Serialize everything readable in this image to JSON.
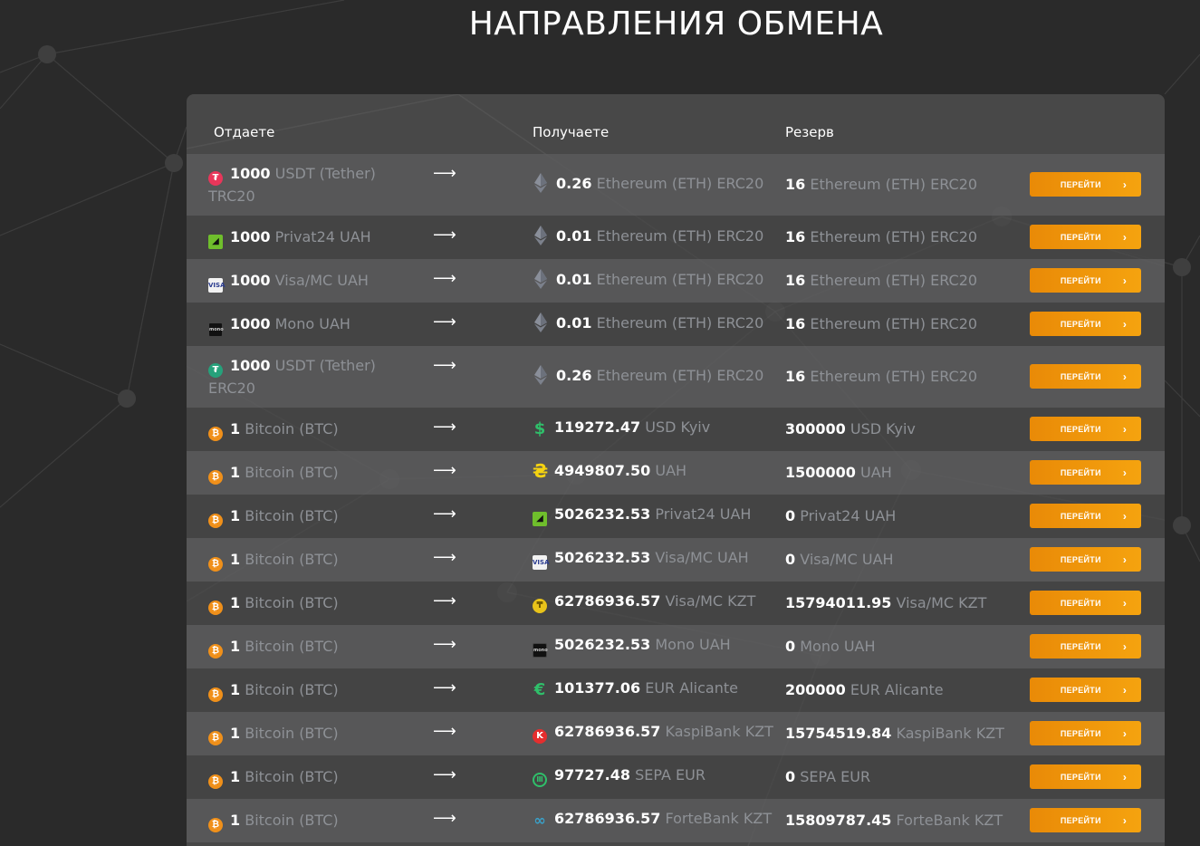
{
  "title": "НАПРАВЛЕНИЯ ОБМЕНА",
  "columns": {
    "give": "Отдаете",
    "get": "Получаете",
    "reserve": "Резерв"
  },
  "button_label": "ПЕРЕЙТИ",
  "rows": [
    {
      "give_icon": "usdt-icon",
      "give_amount": "1000",
      "give_currency": "USDT (Tether) TRC20",
      "get_icon": "ethereum-icon",
      "get_amount": "0.26",
      "get_currency": "Ethereum (ETH) ERC20",
      "reserve_amount": "16",
      "reserve_currency": "Ethereum (ETH) ERC20",
      "tall": true
    },
    {
      "give_icon": "privat24-icon",
      "give_amount": "1000",
      "give_currency": "Privat24 UAH",
      "get_icon": "ethereum-icon",
      "get_amount": "0.01",
      "get_currency": "Ethereum (ETH) ERC20",
      "reserve_amount": "16",
      "reserve_currency": "Ethereum (ETH) ERC20"
    },
    {
      "give_icon": "visa-mc-icon",
      "give_amount": "1000",
      "give_currency": "Visa/MC UAH",
      "get_icon": "ethereum-icon",
      "get_amount": "0.01",
      "get_currency": "Ethereum (ETH) ERC20",
      "reserve_amount": "16",
      "reserve_currency": "Ethereum (ETH) ERC20"
    },
    {
      "give_icon": "mono-icon",
      "give_amount": "1000",
      "give_currency": "Mono UAH",
      "get_icon": "ethereum-icon",
      "get_amount": "0.01",
      "get_currency": "Ethereum (ETH) ERC20",
      "reserve_amount": "16",
      "reserve_currency": "Ethereum (ETH) ERC20"
    },
    {
      "give_icon": "usdt-erc-icon",
      "give_amount": "1000",
      "give_currency": "USDT (Tether) ERC20",
      "get_icon": "ethereum-icon",
      "get_amount": "0.26",
      "get_currency": "Ethereum (ETH) ERC20",
      "reserve_amount": "16",
      "reserve_currency": "Ethereum (ETH) ERC20",
      "tall": true
    },
    {
      "give_icon": "bitcoin-icon",
      "give_amount": "1",
      "give_currency": "Bitcoin (BTC)",
      "get_icon": "dollar-icon",
      "get_amount": "119272.47",
      "get_currency": "USD Kyiv",
      "reserve_amount": "300000",
      "reserve_currency": "USD Kyiv"
    },
    {
      "give_icon": "bitcoin-icon",
      "give_amount": "1",
      "give_currency": "Bitcoin (BTC)",
      "get_icon": "hryvnia-icon",
      "get_amount": "4949807.50",
      "get_currency": "UAH",
      "reserve_amount": "1500000",
      "reserve_currency": "UAH"
    },
    {
      "give_icon": "bitcoin-icon",
      "give_amount": "1",
      "give_currency": "Bitcoin (BTC)",
      "get_icon": "privat24-icon",
      "get_amount": "5026232.53",
      "get_currency": "Privat24 UAH",
      "reserve_amount": "0",
      "reserve_currency": "Privat24 UAH"
    },
    {
      "give_icon": "bitcoin-icon",
      "give_amount": "1",
      "give_currency": "Bitcoin (BTC)",
      "get_icon": "visa-mc-icon",
      "get_amount": "5026232.53",
      "get_currency": "Visa/MC UAH",
      "reserve_amount": "0",
      "reserve_currency": "Visa/MC UAH"
    },
    {
      "give_icon": "bitcoin-icon",
      "give_amount": "1",
      "give_currency": "Bitcoin (BTC)",
      "get_icon": "tenge-icon",
      "get_amount": "62786936.57",
      "get_currency": "Visa/MC KZT",
      "reserve_amount": "15794011.95",
      "reserve_currency": "Visa/MC KZT"
    },
    {
      "give_icon": "bitcoin-icon",
      "give_amount": "1",
      "give_currency": "Bitcoin (BTC)",
      "get_icon": "mono-icon",
      "get_amount": "5026232.53",
      "get_currency": "Mono UAH",
      "reserve_amount": "0",
      "reserve_currency": "Mono UAH"
    },
    {
      "give_icon": "bitcoin-icon",
      "give_amount": "1",
      "give_currency": "Bitcoin (BTC)",
      "get_icon": "euro-icon",
      "get_amount": "101377.06",
      "get_currency": "EUR Alicante",
      "reserve_amount": "200000",
      "reserve_currency": "EUR Alicante"
    },
    {
      "give_icon": "bitcoin-icon",
      "give_amount": "1",
      "give_currency": "Bitcoin (BTC)",
      "get_icon": "kaspi-icon",
      "get_amount": "62786936.57",
      "get_currency": "KaspiBank KZT",
      "reserve_amount": "15754519.84",
      "reserve_currency": "KaspiBank KZT"
    },
    {
      "give_icon": "bitcoin-icon",
      "give_amount": "1",
      "give_currency": "Bitcoin (BTC)",
      "get_icon": "sepa-bank-icon",
      "get_amount": "97727.48",
      "get_currency": "SEPA EUR",
      "reserve_amount": "0",
      "reserve_currency": "SEPA EUR"
    },
    {
      "give_icon": "bitcoin-icon",
      "give_amount": "1",
      "give_currency": "Bitcoin (BTC)",
      "get_icon": "fortebank-icon",
      "get_amount": "62786936.57",
      "get_currency": "ForteBank KZT",
      "reserve_amount": "15809787.45",
      "reserve_currency": "ForteBank KZT"
    }
  ]
}
